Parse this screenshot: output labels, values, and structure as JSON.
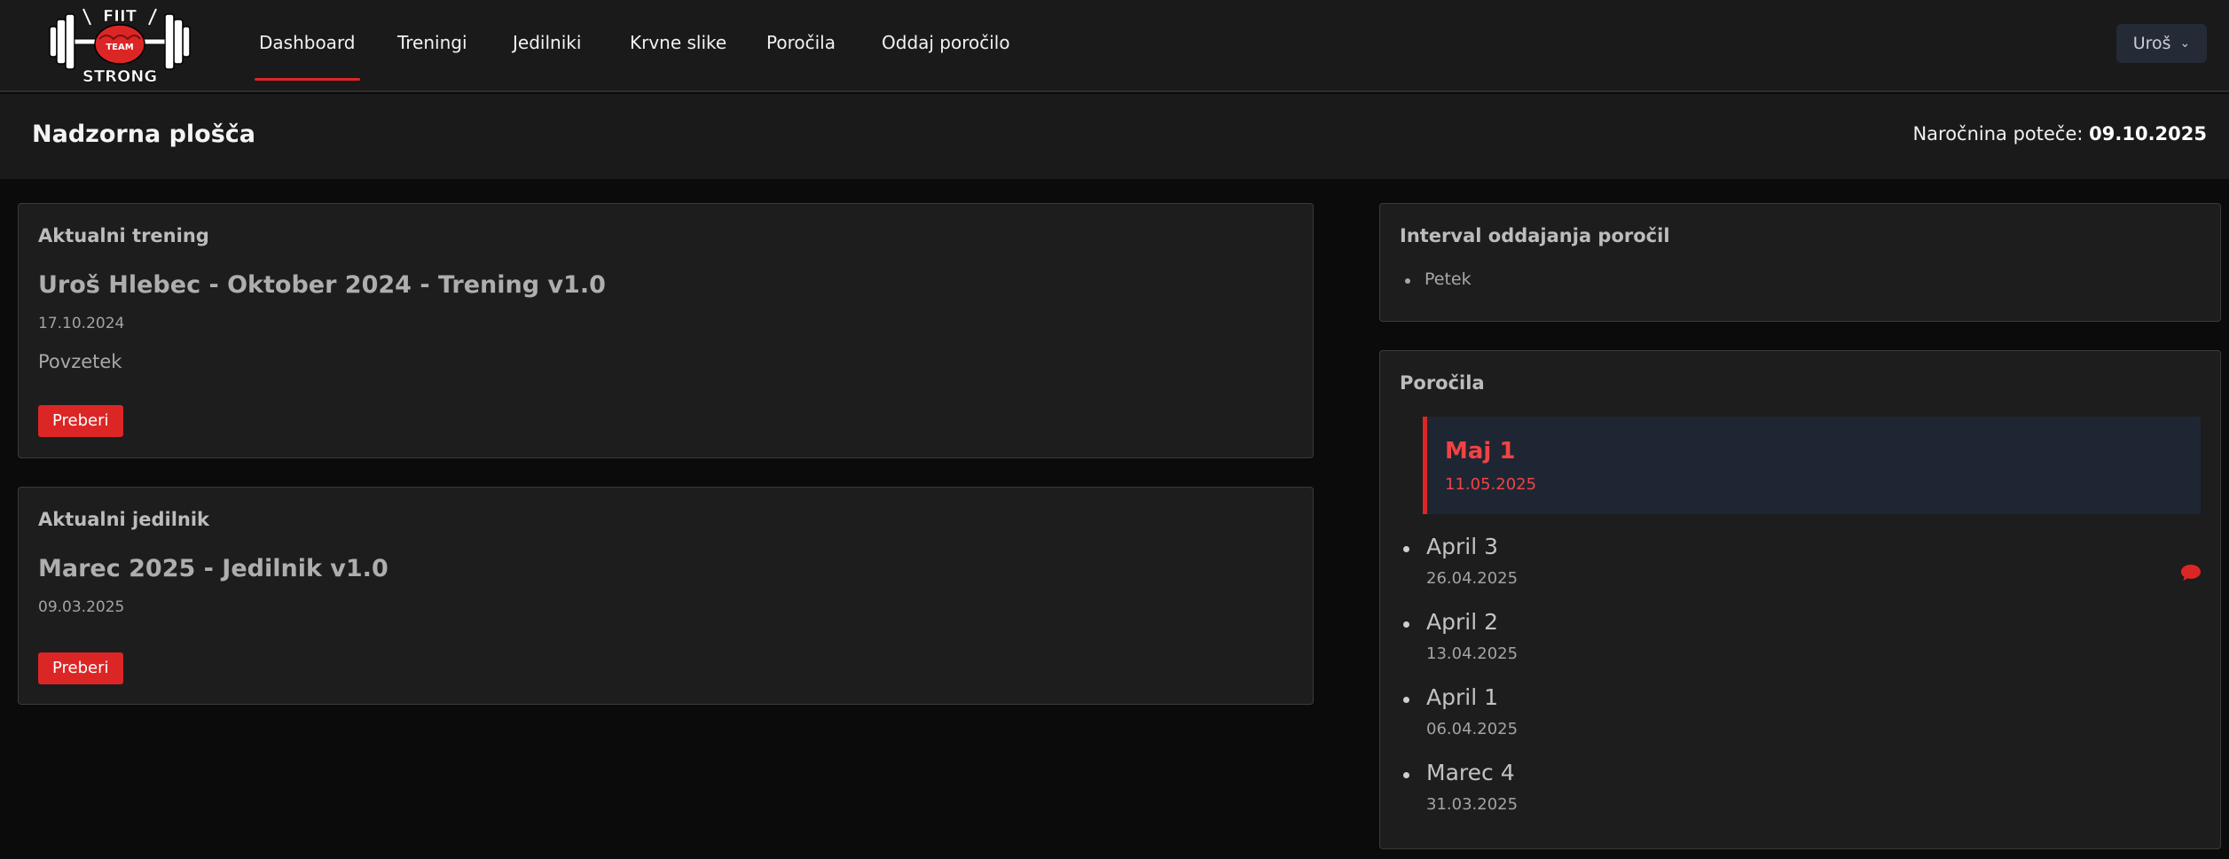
{
  "navbar": {
    "logo": {
      "line1": "FIIT",
      "line2": "TEAM",
      "line3": "STRONG"
    },
    "items": [
      {
        "label": "Dashboard",
        "active": true
      },
      {
        "label": "Treningi",
        "active": false
      },
      {
        "label": "Jedilniki",
        "active": false
      },
      {
        "label": "Krvne slike",
        "active": false
      },
      {
        "label": "Poročila",
        "active": false
      },
      {
        "label": "Oddaj poročilo",
        "active": false
      }
    ],
    "user": {
      "label": "Uroš",
      "icon": "chevron-down-icon"
    }
  },
  "header": {
    "title": "Nadzorna plošča",
    "subscription_label": "Naročnina poteče:",
    "subscription_date": "09.10.2025"
  },
  "training_card": {
    "title": "Aktualni trening",
    "item_title": "Uroš Hlebec - Oktober 2024 - Trening v1.0",
    "date": "17.10.2024",
    "summary": "Povzetek",
    "button": "Preberi"
  },
  "diet_card": {
    "title": "Aktualni jedilnik",
    "item_title": "Marec 2025 - Jedilnik v1.0",
    "date": "09.03.2025",
    "button": "Preberi"
  },
  "interval_card": {
    "title": "Interval oddajanja poročil",
    "items": [
      "Petek"
    ]
  },
  "reports_card": {
    "title": "Poročila",
    "active": {
      "title": "Maj 1",
      "date": "11.05.2025"
    },
    "items": [
      {
        "title": "April 3",
        "date": "26.04.2025",
        "has_comment": true,
        "icon": "comment-icon"
      },
      {
        "title": "April 2",
        "date": "13.04.2025",
        "has_comment": false
      },
      {
        "title": "April 1",
        "date": "06.04.2025",
        "has_comment": false
      },
      {
        "title": "Marec 4",
        "date": "31.03.2025",
        "has_comment": false
      }
    ]
  },
  "colors": {
    "accent": "#dc2626",
    "background": "#0b0b0b",
    "surface": "#1d1d1d",
    "active_report_bg": "#1f2633"
  }
}
